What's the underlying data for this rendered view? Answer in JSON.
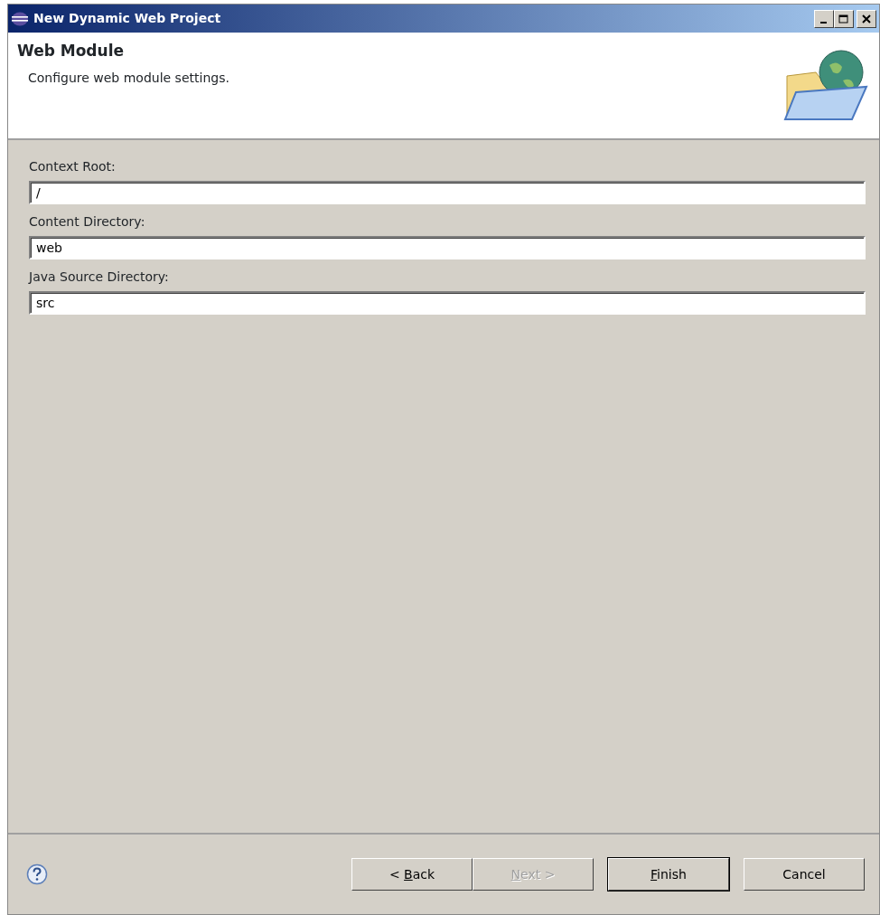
{
  "window": {
    "title": "New Dynamic Web Project"
  },
  "header": {
    "title": "Web Module",
    "description": "Configure web module settings."
  },
  "fields": [
    {
      "label": "Context Root:",
      "value": "/"
    },
    {
      "label": "Content Directory:",
      "value": "web"
    },
    {
      "label": "Java Source Directory:",
      "value": "src"
    }
  ],
  "buttons": [
    {
      "before": "< ",
      "key": "B",
      "after": "ack",
      "disabled": false,
      "default": false
    },
    {
      "key": "N",
      "after": "ext >",
      "disabled": true,
      "default": false
    },
    {
      "key": "F",
      "after": "inish",
      "disabled": false,
      "default": true
    },
    {
      "before": "Cancel",
      "disabled": false,
      "default": false
    }
  ]
}
